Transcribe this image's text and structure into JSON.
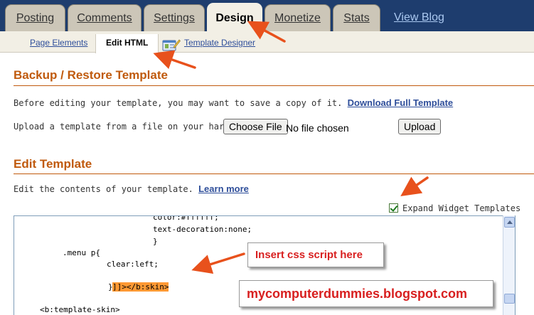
{
  "top_tabs": [
    {
      "label": "Posting",
      "active": false
    },
    {
      "label": "Comments",
      "active": false
    },
    {
      "label": "Settings",
      "active": false
    },
    {
      "label": "Design",
      "active": true
    },
    {
      "label": "Monetize",
      "active": false
    },
    {
      "label": "Stats",
      "active": false
    }
  ],
  "view_blog": "View Blog",
  "sub_tabs": {
    "page_elements": "Page Elements",
    "edit_html": "Edit HTML",
    "template_designer": "Template Designer"
  },
  "backup": {
    "title": "Backup / Restore Template",
    "description": "Before editing your template, you may want to save a copy of it.",
    "download_link": "Download Full Template",
    "upload_label": "Upload a template from a file on your hard drive:",
    "choose_file_button": "Choose File",
    "no_file_text": "No file chosen",
    "upload_button": "Upload"
  },
  "edit": {
    "title": "Edit Template",
    "description": "Edit the contents of your template.",
    "learn_more": "Learn more",
    "expand_widgets_label": "Expand Widget Templates",
    "expand_widgets_checked": true
  },
  "code_lines": [
    "color:#ffffff;",
    "text-decoration:none;",
    "}",
    ".menu p{",
    "clear:left;",
    "}",
    "]]></b:skin>",
    "<b:template-skin>"
  ],
  "annotations": {
    "insert_note": "Insert css script here",
    "site_watermark": "mycomputerdummies.blogspot.com"
  },
  "colors": {
    "top_bar": "#1e3d6e",
    "heading": "#c05a0d",
    "link": "#2e4e9a",
    "highlight": "#ff9933",
    "arrow": "#e8511c",
    "annotation_text": "#d81f1f"
  }
}
